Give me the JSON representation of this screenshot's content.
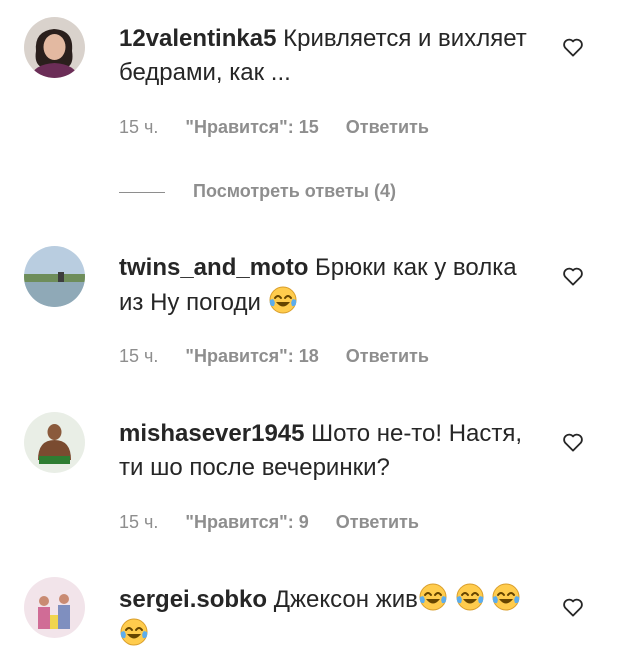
{
  "comments": [
    {
      "username": "12valentinka5",
      "text": "Кривляется и вихляет бедрами, как ...",
      "time": "15 ч.",
      "likes": "\"Нравится\": 15",
      "reply": "Ответить"
    },
    {
      "username": "twins_and_moto",
      "text": "Брюки как у волка из Ну погоди",
      "time": "15 ч.",
      "likes": "\"Нравится\": 18",
      "reply": "Ответить",
      "emojis": [
        "face-with-tears-of-joy"
      ]
    },
    {
      "username": "mishasever1945",
      "text": "Шото не-то! Настя, ти шо после вечеринки?",
      "time": "15 ч.",
      "likes": "\"Нравится\": 9",
      "reply": "Ответить"
    },
    {
      "username": "sergei.sobko",
      "text": "Джексон жив",
      "emojis": [
        "face-with-tears-of-joy",
        "face-with-tears-of-joy",
        "face-with-tears-of-joy",
        "face-with-tears-of-joy"
      ]
    }
  ],
  "view_replies": "Посмотреть ответы (4)",
  "icons": {
    "like": "heart-outline-icon",
    "emoji": "face-with-tears-of-joy"
  },
  "colors": {
    "text": "#262626",
    "secondary": "#8e8e8e",
    "emoji_face": "#ffcc4d",
    "emoji_tears": "#5dadec"
  }
}
